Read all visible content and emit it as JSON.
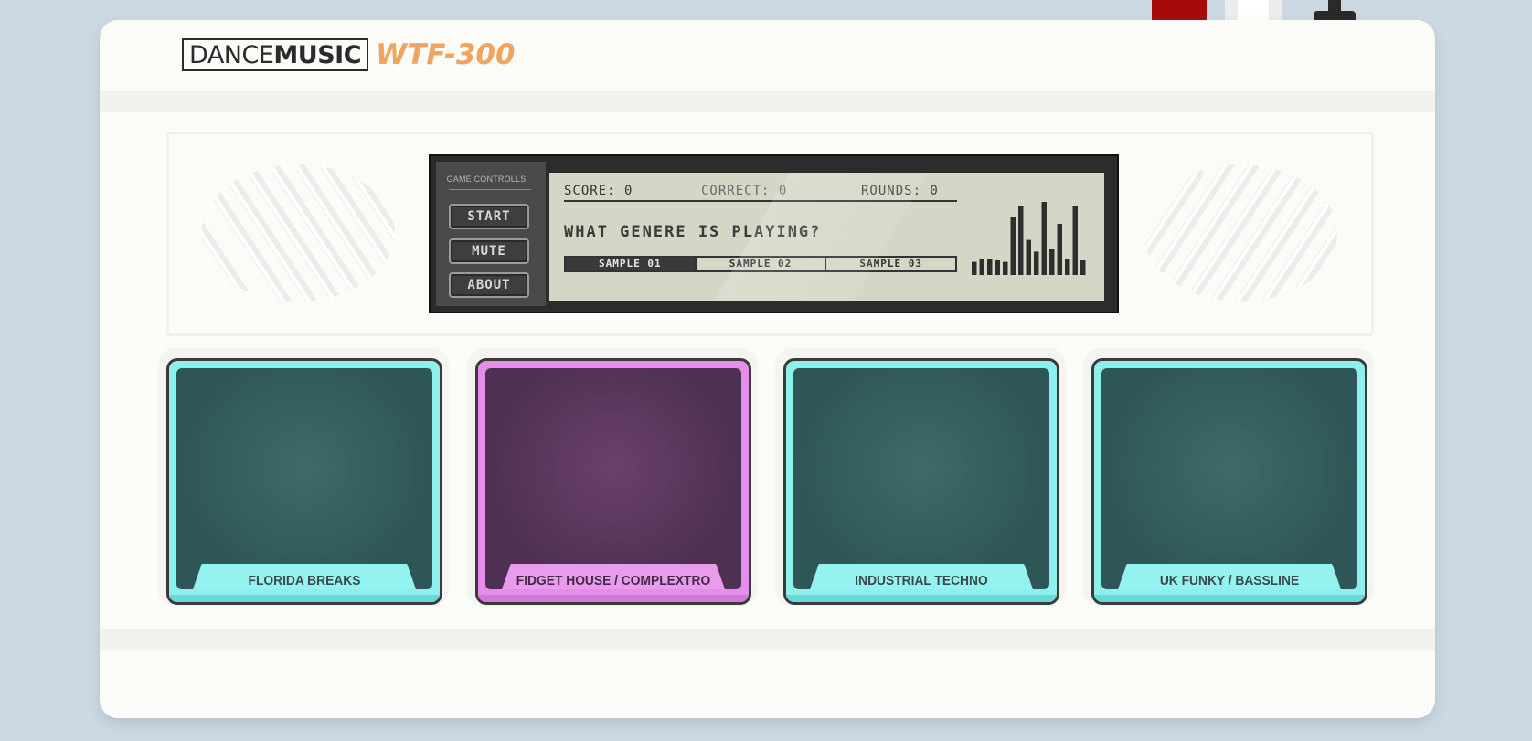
{
  "app": {
    "brand_prefix": "DANCE",
    "brand_bold": "MUSIC",
    "model": "WTF-300"
  },
  "controls": {
    "title": "GAME CONTROLLS",
    "start_label": "START",
    "mute_label": "MUTE",
    "about_label": "ABOUT"
  },
  "display": {
    "score": "SCORE: 0",
    "correct": "CORRECT: 0",
    "rounds": "ROUNDS: 0",
    "question": "WHAT GENERE IS PLAYING?",
    "samples": [
      "SAMPLE 01",
      "SAMPLE 02",
      "SAMPLE 03"
    ],
    "active_sample": 0,
    "equalizer_levels": [
      0.18,
      0.22,
      0.22,
      0.2,
      0.18,
      0.8,
      0.95,
      0.48,
      0.32,
      1.0,
      0.36,
      0.7,
      0.22,
      0.94,
      0.2
    ]
  },
  "pads": [
    {
      "label": "FLORIDA BREAKS",
      "color": "cyan"
    },
    {
      "label": "FIDGET HOUSE / COMPLEXTRO",
      "color": "pink"
    },
    {
      "label": "INDUSTRIAL TECHNO",
      "color": "cyan"
    },
    {
      "label": "UK FUNKY / BASSLINE",
      "color": "cyan"
    }
  ],
  "colors": {
    "accent_orange": "#f0a460",
    "pad_cyan": "#8ef0ee",
    "pad_pink": "#e48ee9",
    "lcd": "#d4d7c6"
  }
}
